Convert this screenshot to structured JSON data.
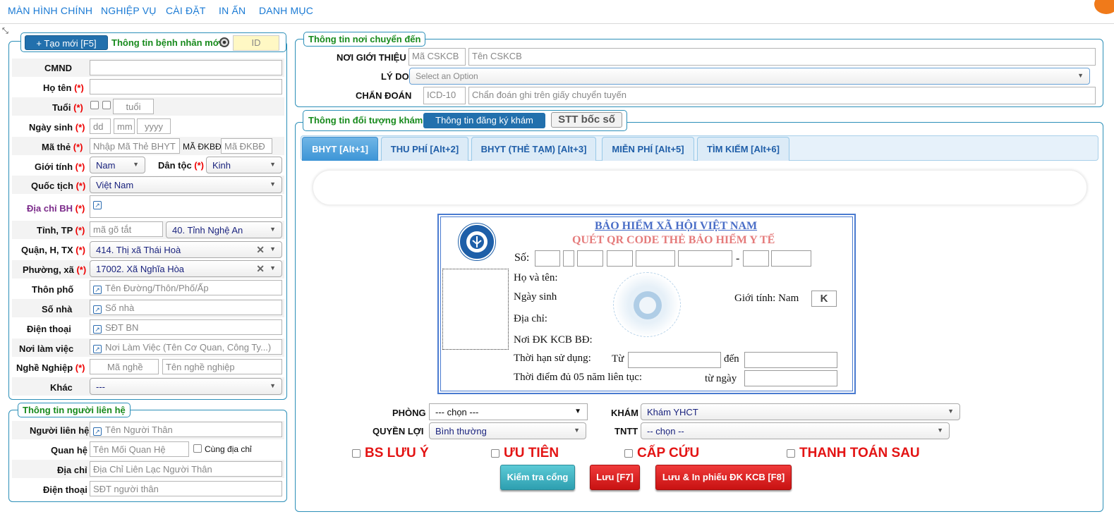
{
  "nav": {
    "items": [
      "MÀN HÌNH CHÍNH",
      "NGHIỆP VỤ",
      "CÀI ĐẶT",
      "IN ẤN",
      "DANH MỤC"
    ]
  },
  "patient": {
    "new_button": "+ Tạo mới [F5]",
    "legend": "Thông tin bệnh nhân mới",
    "id_placeholder": "ID",
    "fields": {
      "cmnd": "CMND",
      "name": "Họ tên",
      "age": "Tuổi",
      "age_placeholder": "tuổi",
      "dob": "Ngày sinh",
      "dob_dd": "dd",
      "dob_mm": "mm",
      "dob_yyyy": "yyyy",
      "card": "Mã thẻ",
      "card_placeholder": "Nhập Mã Thẻ BHYT",
      "kcbbd_label": "MÃ ĐKBĐ",
      "kcbbd_placeholder": "Mã ĐKBĐ",
      "gender": "Giới tính",
      "gender_value": "Nam",
      "ethnic": "Dân tộc",
      "ethnic_value": "Kinh",
      "nationality": "Quốc tịch",
      "nationality_value": "Việt Nam",
      "address_bh": "Địa chỉ BH",
      "province": "Tỉnh, TP",
      "province_code_placeholder": "mã gõ tắt",
      "province_value": "40. Tỉnh Nghệ An",
      "district": "Quận, H, TX",
      "district_value": "414. Thị xã Thái Hoà",
      "ward": "Phường, xã",
      "ward_value": "17002. Xã Nghĩa Hòa",
      "hamlet": "Thôn phố",
      "hamlet_placeholder": "Tên Đường/Thôn/Phố/Ấp",
      "house": "Số nhà",
      "house_placeholder": "Số nhà",
      "phone": "Điện thoại",
      "phone_placeholder": "SĐT BN",
      "work": "Nơi làm việc",
      "work_placeholder": "Nơi Làm Việc (Tên Cơ Quan, Công Ty...)",
      "job": "Nghề Nghiệp",
      "job_code_placeholder": "Mã nghề",
      "job_name_placeholder": "Tên nghề nghiệp",
      "other": "Khác",
      "other_value": "---",
      "required_mark": "(*)"
    }
  },
  "contact": {
    "legend": "Thông tin người liên hệ",
    "person": "Người liên hệ",
    "person_placeholder": "Tên Người Thân",
    "relation": "Quan hệ",
    "relation_placeholder": "Tên Mối Quan Hệ",
    "same_address": "Cùng địa chỉ",
    "address": "Địa chỉ",
    "address_placeholder": "Địa Chỉ Liên Lạc Người Thân",
    "phone": "Điện thoại",
    "phone_placeholder": "SĐT người thân"
  },
  "referral": {
    "legend": "Thông tin nơi chuyển đến",
    "source": "NƠI GIỚI THIỆU",
    "source_code_placeholder": "Mã CSKCB",
    "source_name_placeholder": "Tên CSKCB",
    "reason": "LÝ DO",
    "reason_placeholder": "Select an Option",
    "diagnosis": "CHẨN ĐOÁN",
    "icd_placeholder": "ICD-10",
    "diagnosis_placeholder": "Chẩn đoán ghi trên giấy chuyển tuyến"
  },
  "exam": {
    "legend": "Thông tin đối tượng khám",
    "register_button": "Thông tin đăng ký khám",
    "ticket_button": "STT bốc số",
    "tabs": [
      "BHYT [Alt+1]",
      "THU PHÍ [Alt+2]",
      "BHYT (THẺ TẠM) [Alt+3]",
      "MIỄN PHÍ [Alt+5]",
      "TÌM KIẾM [Alt+6]"
    ],
    "card": {
      "title1": "BẢO HIỂM XÃ HỘI VIỆT NAM",
      "title2": "QUÉT QR CODE THẺ BẢO HIỂM Y TẾ",
      "number": "Số:",
      "dash": "-",
      "name": "Họ và tên:",
      "dob": "Ngày sinh",
      "gender": "Giới tính: Nam",
      "gender_box": "K",
      "address": "Địa chỉ:",
      "kcbbd": "Nơi ĐK KCB BĐ:",
      "valid": "Thời hạn sử dụng:",
      "from": "Từ",
      "to": "đến",
      "five_years": "Thời điểm đủ 05 năm liên tục:",
      "since": "từ ngày"
    },
    "room": "PHÒNG",
    "room_value": "--- chọn ---",
    "clinic": "KHÁM",
    "clinic_value": "Khám YHCT",
    "benefit": "QUYỀN LỢI",
    "benefit_value": "Bình thường",
    "tntt": "TNTT",
    "tntt_value": "-- chọn --",
    "flags": [
      "BS LƯU Ý",
      "ƯU TIÊN",
      "CẤP CỨU",
      "THANH TOÁN SAU"
    ],
    "check_button": "Kiểm tra cổng",
    "save_button": "Lưu [F7]",
    "save_print_button": "Lưu & In phiếu ĐK KCB [F8]"
  },
  "colors": {
    "accent": "#1a7ad4",
    "legend_green": "#178a1c",
    "danger": "#e31414",
    "teal": "#3fb6c7"
  }
}
